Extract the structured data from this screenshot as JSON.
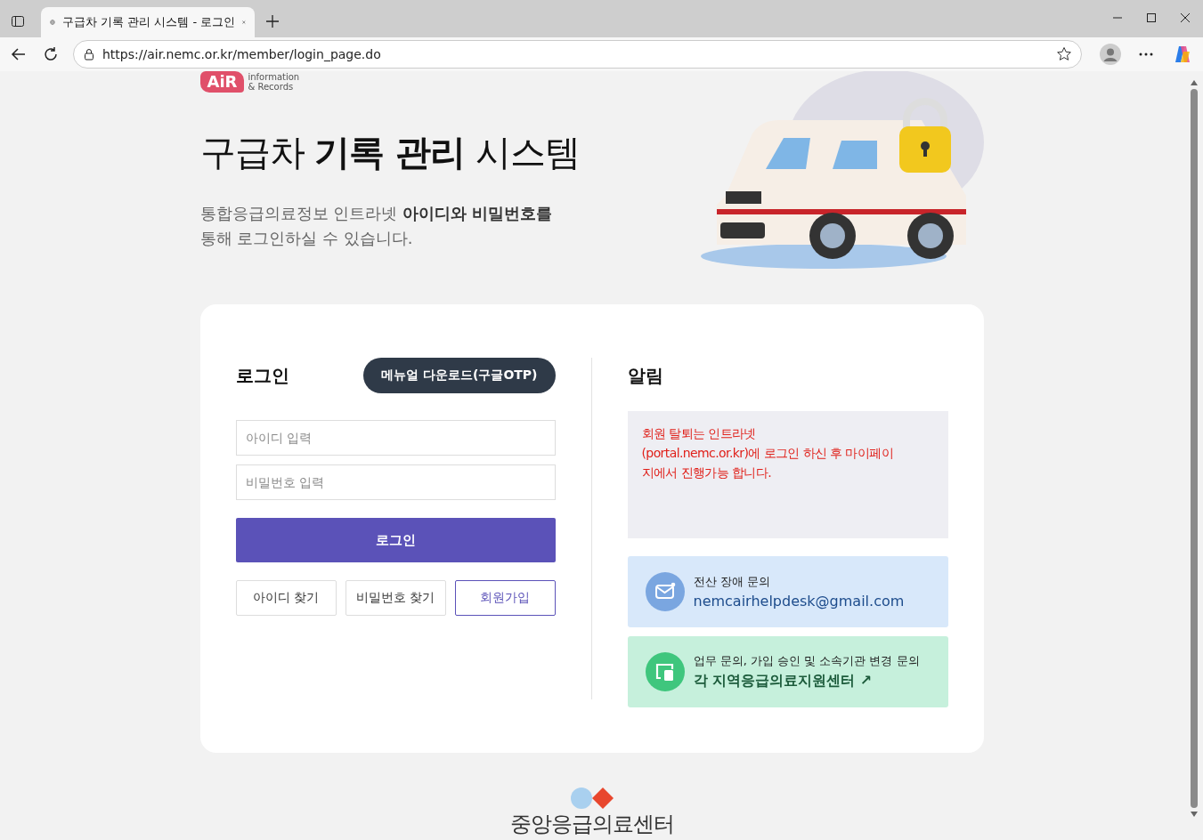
{
  "browser": {
    "tab_title": "구급차 기록 관리 시스템 - 로그인",
    "url": "https://air.nemc.or.kr/member/login_page.do"
  },
  "logo": {
    "mark": "AiR",
    "line1": "information",
    "line2": "& Records"
  },
  "hero": {
    "title": "구급차 **기록 관리** 시스템",
    "description": "통합응급의료정보 인트라넷 **아이디와 비밀번호를**\n통해 로그인하실 수 있습니다."
  },
  "login": {
    "heading": "로그인",
    "manual_button": "메뉴얼 다운로드(구글OTP)",
    "id_placeholder": "아이디 입력",
    "password_placeholder": "비밀번호 입력",
    "submit": "로그인",
    "links": [
      {
        "label": "아이디 찾기",
        "kind": "plain"
      },
      {
        "label": "비밀번호 찾기",
        "kind": "plain"
      },
      {
        "label": "회원가입",
        "kind": "primary"
      }
    ]
  },
  "notice": {
    "heading": "알림",
    "message": "회원 탈퇴는 인트라넷\n(portal.nemc.or.kr)에 로그인 하신 후 마이페이\n지에서 진행가능 합니다.",
    "contacts": [
      {
        "kind": "email",
        "label": "전산 장애 문의",
        "value": "nemcairhelpdesk@gmail.com"
      },
      {
        "kind": "center",
        "label": "업무 문의, 가입 승인 및 소속기관 변경 문의",
        "value": "각 지역응급의료지원센터 ↗"
      }
    ]
  },
  "footer": {
    "org": "중앙응급의료센터"
  }
}
